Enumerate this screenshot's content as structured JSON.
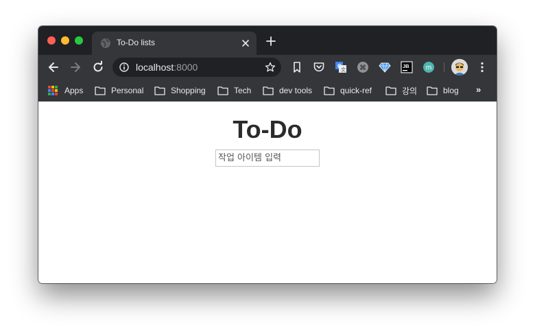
{
  "browser": {
    "tab": {
      "title": "To-Do lists"
    },
    "address": {
      "host": "localhost",
      "port": ":8000"
    },
    "bookmarks": [
      {
        "label": "Apps",
        "icon": "apps-grid-icon"
      },
      {
        "label": "Personal",
        "icon": "folder-icon"
      },
      {
        "label": "Shopping",
        "icon": "folder-icon"
      },
      {
        "label": "Tech",
        "icon": "folder-icon"
      },
      {
        "label": "dev tools",
        "icon": "folder-icon"
      },
      {
        "label": "quick-ref",
        "icon": "folder-icon"
      },
      {
        "label": "강의",
        "icon": "folder-icon"
      },
      {
        "label": "blog",
        "icon": "folder-icon"
      }
    ],
    "bookmarks_overflow": "»",
    "extensions": {
      "jb_label": "JB",
      "m_label": "m"
    },
    "colors": {
      "frame": "#202124",
      "toolbar": "#35363a",
      "text": "#e8eaed"
    }
  },
  "page": {
    "heading": "To-Do",
    "input_placeholder": "작업 아이템 입력",
    "input_value": ""
  }
}
